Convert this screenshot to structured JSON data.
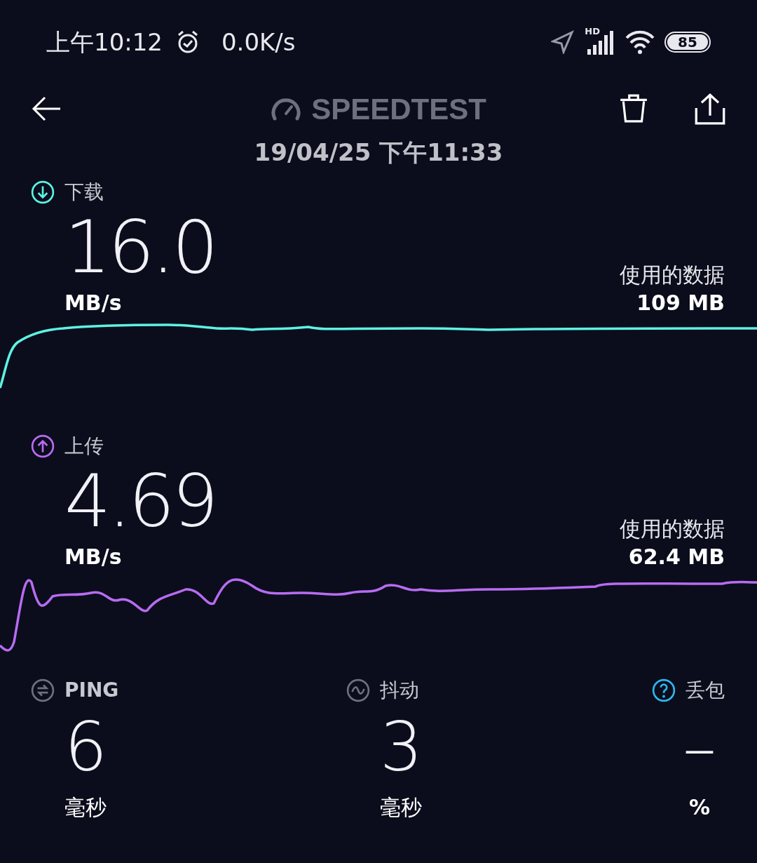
{
  "status_bar": {
    "time": "上午10:12",
    "net_speed": "0.0K/s",
    "network_type": "HD",
    "battery": "85"
  },
  "header": {
    "title": "SPEEDTEST",
    "date": "19/04/25 下午11:33"
  },
  "tests": [
    {
      "kind": "download",
      "label": "下载",
      "value": "16.0",
      "unit": "MB/s",
      "data_label": "使用的数据",
      "data_value": "109 MB",
      "color": "#5ef2e4"
    },
    {
      "kind": "upload",
      "label": "上传",
      "value": "4.69",
      "unit": "MB/s",
      "data_label": "使用的数据",
      "data_value": "62.4 MB",
      "color": "#b86cf2"
    }
  ],
  "metrics": [
    {
      "kind": "ping",
      "label": "PING",
      "value": "6",
      "unit": "毫秒"
    },
    {
      "kind": "jitter",
      "label": "抖动",
      "value": "3",
      "unit": "毫秒"
    },
    {
      "kind": "packet_loss",
      "label": "丢包",
      "value": "–",
      "unit": "%"
    }
  ]
}
